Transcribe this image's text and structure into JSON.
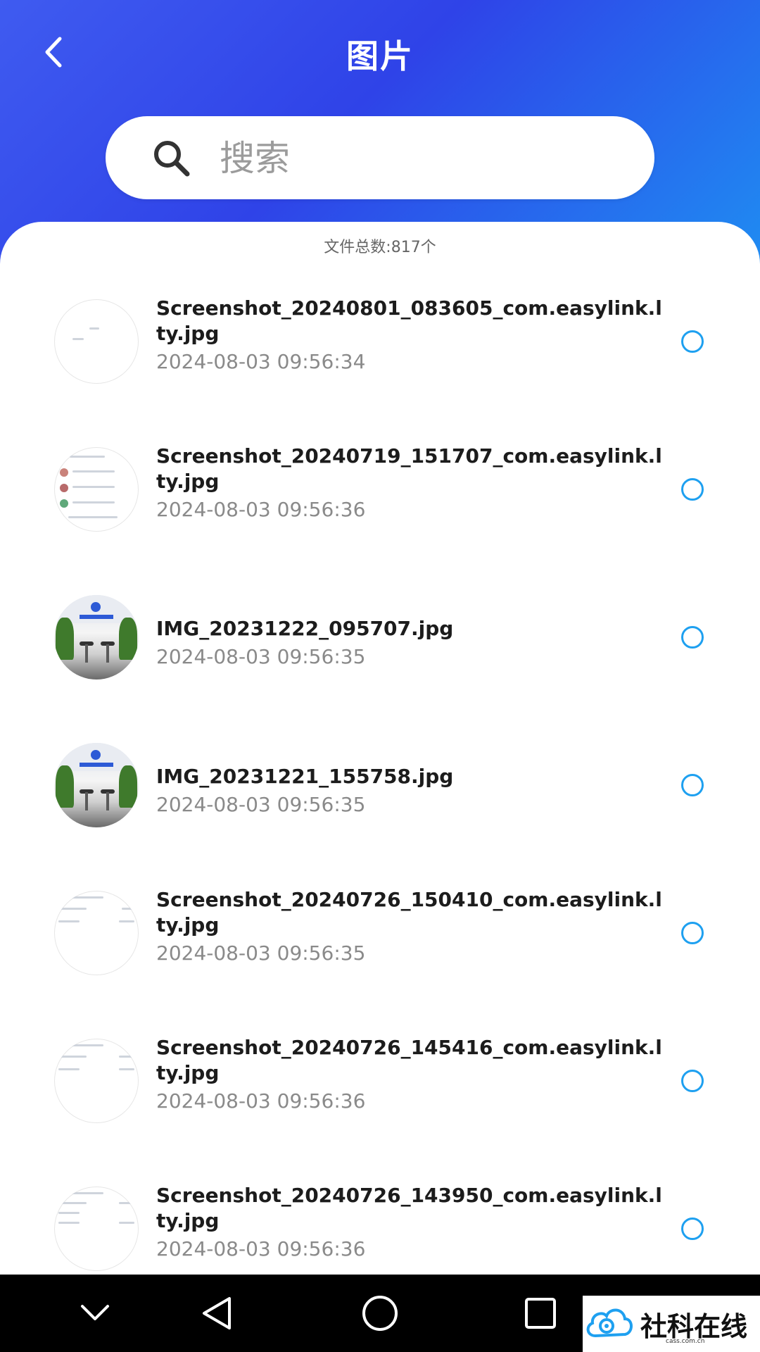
{
  "header": {
    "title": "图片",
    "back_icon": "chevron-left-icon"
  },
  "search": {
    "placeholder": "搜索",
    "icon": "search-icon"
  },
  "file_count": "文件总数:817个",
  "files": [
    {
      "name": "Screenshot_20240801_083605_com.easylink.lty.jpg",
      "date": "2024-08-03 09:56:34",
      "thumb": "screenshot"
    },
    {
      "name": "Screenshot_20240719_151707_com.easylink.lty.jpg",
      "date": "2024-08-03 09:56:36",
      "thumb": "screenshot"
    },
    {
      "name": "IMG_20231222_095707.jpg",
      "date": "2024-08-03 09:56:35",
      "thumb": "photo"
    },
    {
      "name": "IMG_20231221_155758.jpg",
      "date": "2024-08-03 09:56:35",
      "thumb": "photo"
    },
    {
      "name": "Screenshot_20240726_150410_com.easylink.lty.jpg",
      "date": "2024-08-03 09:56:35",
      "thumb": "screenshot"
    },
    {
      "name": "Screenshot_20240726_145416_com.easylink.lty.jpg",
      "date": "2024-08-03 09:56:36",
      "thumb": "screenshot"
    },
    {
      "name": "Screenshot_20240726_143950_com.easylink.lty.jpg",
      "date": "2024-08-03 09:56:36",
      "thumb": "screenshot"
    }
  ],
  "nav": {
    "buttons": [
      "chevron-down-icon",
      "back-triangle-icon",
      "home-circle-icon",
      "recents-square-icon"
    ]
  },
  "watermark": {
    "title": "社科在线",
    "subtitle": "cass.com.cn"
  },
  "colors": {
    "header_gradient_start": "#3f5bf0",
    "header_gradient_end": "#1f8df2",
    "radio_border": "#1ea0f0"
  }
}
